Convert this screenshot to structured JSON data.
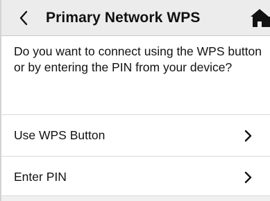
{
  "header": {
    "title": "Primary Network WPS",
    "back_icon": "chevron-left-icon",
    "home_icon": "home-icon"
  },
  "prompt": {
    "text": "Do you want to connect using the WPS button or by entering the PIN from your device?"
  },
  "options": [
    {
      "label": "Use WPS Button",
      "icon": "chevron-right-icon"
    },
    {
      "label": "Enter PIN",
      "icon": "chevron-right-icon"
    }
  ],
  "colors": {
    "header_bg": "#ececec",
    "text": "#111111",
    "divider": "#d9d9d9"
  }
}
